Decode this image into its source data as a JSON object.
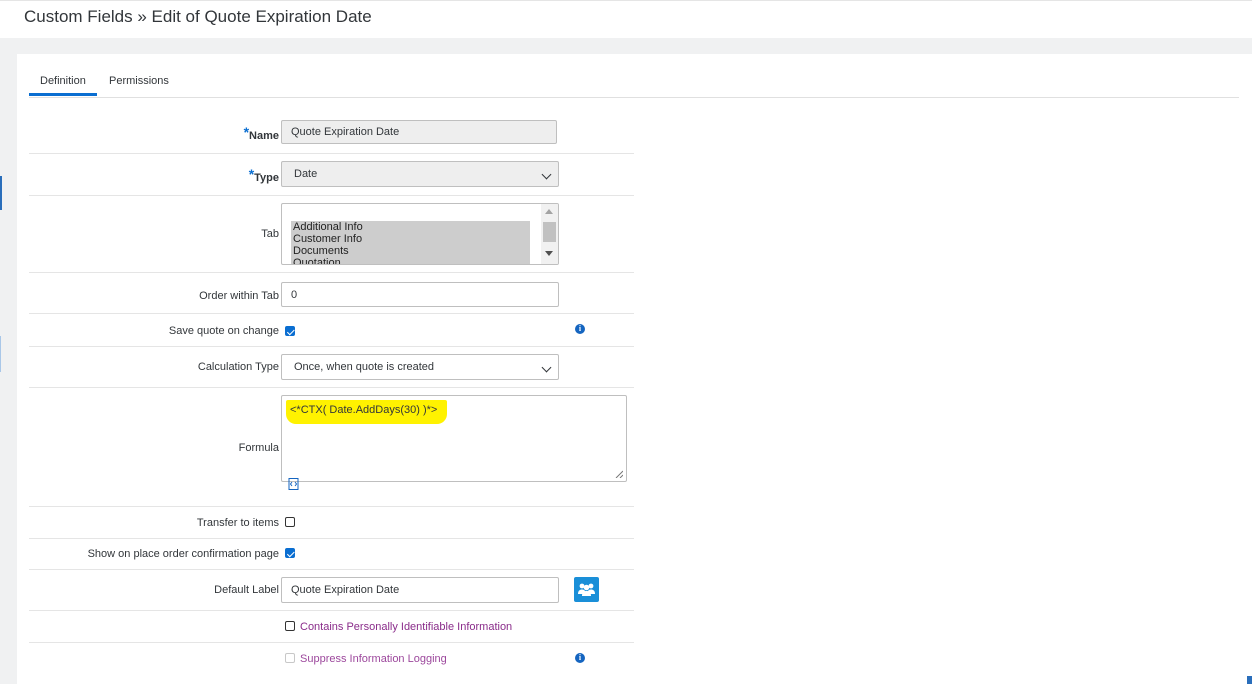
{
  "page": {
    "title": "Custom Fields » Edit of Quote Expiration Date"
  },
  "tabs": [
    {
      "label": "Definition",
      "active": true
    },
    {
      "label": "Permissions",
      "active": false
    }
  ],
  "form": {
    "name": {
      "label": "Name",
      "required_mark": "*",
      "value": "Quote Expiration Date"
    },
    "type": {
      "label": "Type",
      "required_mark": "*",
      "value": "Date"
    },
    "tab": {
      "label": "Tab",
      "options": [
        "Additional Info",
        "Customer Info",
        "Documents",
        "Quotation"
      ]
    },
    "order_within_tab": {
      "label": "Order within Tab",
      "value": "0"
    },
    "save_quote_on_change": {
      "label": "Save quote on change",
      "checked": true
    },
    "calculation_type": {
      "label": "Calculation Type",
      "value": "Once, when quote is created"
    },
    "formula": {
      "label": "Formula",
      "value": "<*CTX( Date.AddDays(30) )*>"
    },
    "transfer_to_items": {
      "label": "Transfer to items",
      "checked": false
    },
    "show_on_confirmation": {
      "label": "Show on place order confirmation page",
      "checked": true
    },
    "default_label": {
      "label": "Default Label",
      "value": "Quote Expiration Date"
    },
    "pii": {
      "label": "Contains Personally Identifiable Information",
      "checked": false
    },
    "suppress_logging": {
      "label": "Suppress Information Logging",
      "checked": false
    }
  },
  "colors": {
    "accent": "#0a6ed1",
    "highlight": "#fff200",
    "link_purple": "#8a2c8a",
    "info_blue": "#1565c0"
  },
  "icons": [
    "info-icon",
    "code-icon",
    "people-icon",
    "chevron-down-icon"
  ]
}
